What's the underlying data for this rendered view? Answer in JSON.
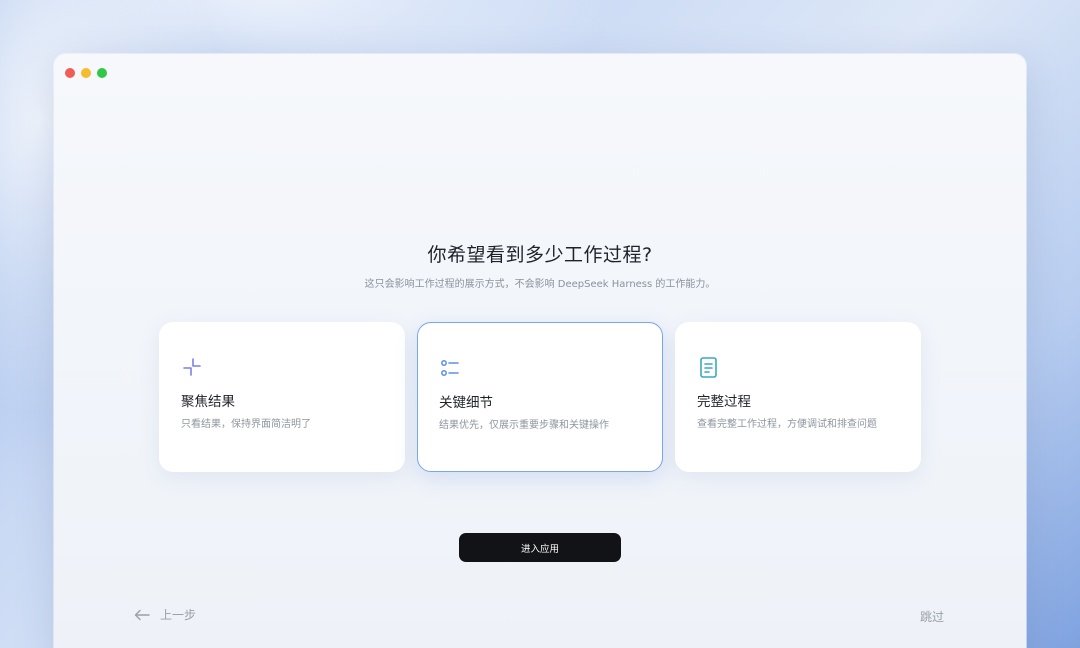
{
  "window": {
    "title": "你希望看到多少工作过程?",
    "subtitle": "这只会影响工作过程的展示方式，不会影响 DeepSeek Harness 的工作能力。"
  },
  "options": [
    {
      "icon": "collapse-arrows-icon",
      "label": "聚焦结果",
      "description": "只看结果，保持界面简洁明了",
      "selected": false
    },
    {
      "icon": "list-icon",
      "label": "关键细节",
      "description": "结果优先，仅展示重要步骤和关键操作",
      "selected": true
    },
    {
      "icon": "document-icon",
      "label": "完整过程",
      "description": "查看完整工作过程，方便调试和排查问题",
      "selected": false
    }
  ],
  "actions": {
    "enter_label": "进入应用",
    "back_label": "上一步",
    "skip_label": "跳过"
  },
  "colors": {
    "accent_border": "#7aa6ea",
    "icon_purple": "#7c7ff0",
    "icon_blue": "#5b8fe6",
    "icon_teal": "#3aa8c4",
    "button_dark": "#121317"
  }
}
